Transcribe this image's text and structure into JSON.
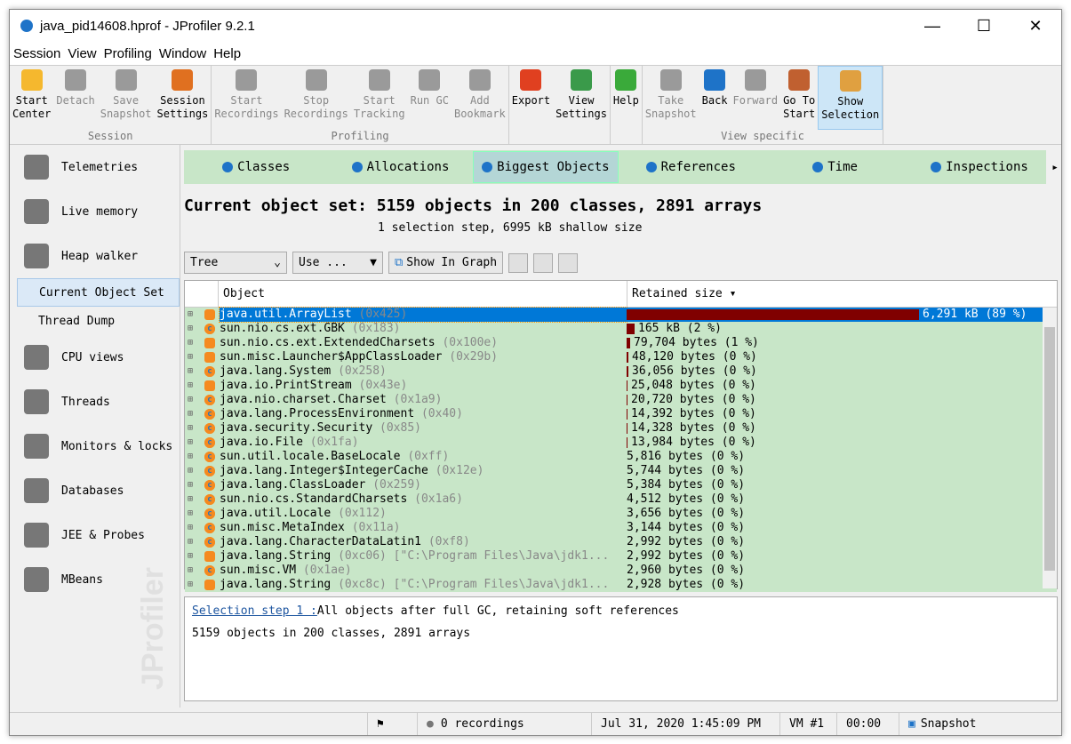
{
  "window": {
    "title": "java_pid14608.hprof - JProfiler 9.2.1",
    "controls": [
      "—",
      "☐",
      "✕"
    ]
  },
  "menu": [
    "Session",
    "View",
    "Profiling",
    "Window",
    "Help"
  ],
  "toolbar": [
    {
      "group": "Session",
      "buttons": [
        {
          "label": "Start\nCenter",
          "icon": "folder-play-icon",
          "enabled": true,
          "color": "#f5b82e"
        },
        {
          "label": "Detach",
          "icon": "unplug-icon",
          "enabled": false
        },
        {
          "label": "Save\nSnapshot",
          "icon": "floppy-icon",
          "enabled": false
        },
        {
          "label": "Session\nSettings",
          "icon": "clipboard-edit-icon",
          "enabled": true,
          "color": "#e07020"
        }
      ]
    },
    {
      "group": "Profiling",
      "buttons": [
        {
          "label": "Start\nRecordings",
          "icon": "record-icon",
          "enabled": false
        },
        {
          "label": "Stop\nRecordings",
          "icon": "stop-record-icon",
          "enabled": false
        },
        {
          "label": "Start\nTracking",
          "icon": "tracking-icon",
          "enabled": false
        },
        {
          "label": "Run GC",
          "icon": "recycle-icon",
          "enabled": false
        },
        {
          "label": "Add\nBookmark",
          "icon": "bookmark-icon",
          "enabled": false
        }
      ]
    },
    {
      "group": "",
      "buttons": [
        {
          "label": "Export",
          "icon": "export-icon",
          "enabled": true,
          "color": "#e04020"
        },
        {
          "label": "View\nSettings",
          "icon": "view-settings-icon",
          "enabled": true,
          "color": "#3a9a4a"
        }
      ]
    },
    {
      "group": "",
      "buttons": [
        {
          "label": "Help",
          "icon": "help-icon",
          "enabled": true,
          "color": "#3aaa3a"
        }
      ]
    },
    {
      "group": "View specific",
      "buttons": [
        {
          "label": "Take\nSnapshot",
          "icon": "camera-icon",
          "enabled": false
        },
        {
          "label": "Back",
          "icon": "back-icon",
          "enabled": true,
          "color": "#1e73c8"
        },
        {
          "label": "Forward",
          "icon": "forward-icon",
          "enabled": false
        },
        {
          "label": "Go To\nStart",
          "icon": "home-icon",
          "enabled": true,
          "color": "#c06030"
        },
        {
          "label": "Show\nSelection",
          "icon": "show-selection-icon",
          "enabled": true,
          "selected": true,
          "color": "#e0a040"
        }
      ]
    }
  ],
  "sidebar": {
    "items": [
      {
        "label": "Telemetries",
        "icon": "telemetries-icon"
      },
      {
        "label": "Live memory",
        "icon": "live-memory-icon"
      },
      {
        "label": "Heap walker",
        "icon": "heap-walker-icon",
        "sub": [
          {
            "label": "Current Object Set",
            "selected": true
          },
          {
            "label": "Thread Dump"
          }
        ]
      },
      {
        "label": "CPU views",
        "icon": "cpu-icon"
      },
      {
        "label": "Threads",
        "icon": "threads-icon"
      },
      {
        "label": "Monitors & locks",
        "icon": "lock-icon"
      },
      {
        "label": "Databases",
        "icon": "database-icon"
      },
      {
        "label": "JEE & Probes",
        "icon": "gauge-icon"
      },
      {
        "label": "MBeans",
        "icon": "globe-icon"
      }
    ],
    "watermark": "JProfiler"
  },
  "tabs": [
    {
      "label": "Classes",
      "icon": "classes-icon"
    },
    {
      "label": "Allocations",
      "icon": "allocations-icon"
    },
    {
      "label": "Biggest Objects",
      "icon": "biggest-objects-icon",
      "selected": true
    },
    {
      "label": "References",
      "icon": "references-icon"
    },
    {
      "label": "Time",
      "icon": "time-icon"
    },
    {
      "label": "Inspections",
      "icon": "inspections-icon"
    }
  ],
  "heading": "Current object set: 5159 objects in 200 classes, 2891 arrays",
  "subheading": "1 selection step, 6995 kB shallow size",
  "controls": {
    "view": "Tree",
    "use": "Use ...",
    "show_graph": "Show In Graph"
  },
  "table": {
    "columns": [
      "Object",
      "Retained size ▾"
    ],
    "rows": [
      {
        "name": "java.util.ArrayList",
        "addr": "(0x425)",
        "kind": "object",
        "size": "6,291 kB (89 %)",
        "bytes": 6442000,
        "selected": true
      },
      {
        "name": "sun.nio.cs.ext.GBK",
        "addr": "(0x183)",
        "kind": "class",
        "size": "165 kB (2 %)",
        "bytes": 168960
      },
      {
        "name": "sun.nio.cs.ext.ExtendedCharsets",
        "addr": "(0x100e)",
        "kind": "object",
        "size": "79,704 bytes (1 %)",
        "bytes": 79704
      },
      {
        "name": "sun.misc.Launcher$AppClassLoader",
        "addr": "(0x29b)",
        "kind": "object",
        "size": "48,120 bytes (0 %)",
        "bytes": 48120
      },
      {
        "name": "java.lang.System",
        "addr": "(0x258)",
        "kind": "class",
        "size": "36,056 bytes (0 %)",
        "bytes": 36056
      },
      {
        "name": "java.io.PrintStream",
        "addr": "(0x43e)",
        "kind": "object",
        "size": "25,048 bytes (0 %)",
        "bytes": 25048
      },
      {
        "name": "java.nio.charset.Charset",
        "addr": "(0x1a9)",
        "kind": "class",
        "size": "20,720 bytes (0 %)",
        "bytes": 20720
      },
      {
        "name": "java.lang.ProcessEnvironment",
        "addr": "(0x40)",
        "kind": "class",
        "size": "14,392 bytes (0 %)",
        "bytes": 14392
      },
      {
        "name": "java.security.Security",
        "addr": "(0x85)",
        "kind": "class",
        "size": "14,328 bytes (0 %)",
        "bytes": 14328
      },
      {
        "name": "java.io.File",
        "addr": "(0x1fa)",
        "kind": "class",
        "size": "13,984 bytes (0 %)",
        "bytes": 13984
      },
      {
        "name": "sun.util.locale.BaseLocale",
        "addr": "(0xff)",
        "kind": "class",
        "size": "5,816 bytes (0 %)",
        "bytes": 5816
      },
      {
        "name": "java.lang.Integer$IntegerCache",
        "addr": "(0x12e)",
        "kind": "class",
        "size": "5,744 bytes (0 %)",
        "bytes": 5744
      },
      {
        "name": "java.lang.ClassLoader",
        "addr": "(0x259)",
        "kind": "class",
        "size": "5,384 bytes (0 %)",
        "bytes": 5384
      },
      {
        "name": "sun.nio.cs.StandardCharsets",
        "addr": "(0x1a6)",
        "kind": "class",
        "size": "4,512 bytes (0 %)",
        "bytes": 4512
      },
      {
        "name": "java.util.Locale",
        "addr": "(0x112)",
        "kind": "class",
        "size": "3,656 bytes (0 %)",
        "bytes": 3656
      },
      {
        "name": "sun.misc.MetaIndex",
        "addr": "(0x11a)",
        "kind": "class",
        "size": "3,144 bytes (0 %)",
        "bytes": 3144
      },
      {
        "name": "java.lang.CharacterDataLatin1",
        "addr": "(0xf8)",
        "kind": "class",
        "size": "2,992 bytes (0 %)",
        "bytes": 2992
      },
      {
        "name": "java.lang.String",
        "addr": "(0xc06) [\"C:\\Program Files\\Java\\jdk1...",
        "kind": "object",
        "size": "2,992 bytes (0 %)",
        "bytes": 2992
      },
      {
        "name": "sun.misc.VM",
        "addr": "(0x1ae)",
        "kind": "class",
        "size": "2,960 bytes (0 %)",
        "bytes": 2960
      },
      {
        "name": "java.lang.String",
        "addr": "(0xc8c) [\"C:\\Program Files\\Java\\jdk1...",
        "kind": "object",
        "size": "2,928 bytes (0 %)",
        "bytes": 2928
      }
    ]
  },
  "detail": {
    "link": "Selection step 1 :",
    "text": "All objects after full GC, retaining soft references",
    "summary": "5159 objects in 200 classes, 2891 arrays"
  },
  "status": {
    "recordings": "0 recordings",
    "datetime": "Jul 31, 2020 1:45:09 PM",
    "vm": "VM #1",
    "time": "00:00",
    "snapshot": "Snapshot"
  },
  "colors": {
    "bar": "#800000",
    "selection": "#0078d7",
    "row_bg": "#c8e6c8"
  }
}
